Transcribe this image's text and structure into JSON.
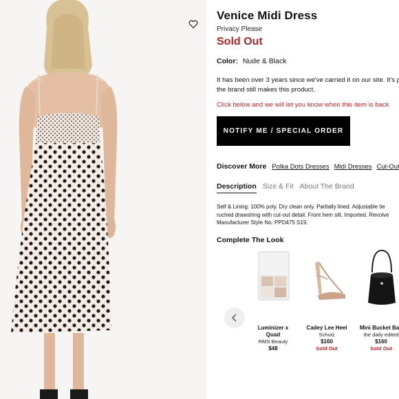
{
  "product": {
    "title": "Venice Midi Dress",
    "brand": "Privacy Please",
    "status": "Sold Out",
    "color_label": "Color:",
    "color_value": "Nude & Black",
    "availability_note": "It has been over 3 years since we've carried it on our site. It's possible the brand still makes this product.",
    "notify_prompt": "Click below and we will let you know when this item is back",
    "notify_button": "NOTIFY ME / SPECIAL ORDER"
  },
  "discover": {
    "label": "Discover More",
    "links": [
      "Polka Dots Dresses",
      "Midi Dresses",
      "Cut-Out"
    ]
  },
  "tabs": [
    {
      "label": "Description",
      "active": true
    },
    {
      "label": "Size & Fit",
      "active": false
    },
    {
      "label": "About The Brand",
      "active": false
    }
  ],
  "description": {
    "line1": "Self & Lining: 100% poly. Dry clean only. Partially lined. Adjustable tie",
    "line2": "ruched drawstring with cut-out detail. Front hem slit. Imported. Revolve",
    "line3": "Manufacturer Style No. PPD475 S19."
  },
  "complete_the_look": {
    "heading": "Complete The Look",
    "items": [
      {
        "name_line1": "Luminizer x",
        "name_line2": "Quad",
        "brand": "RMS Beauty",
        "price": "$48",
        "status": ""
      },
      {
        "name_line1": "Cadey Lee Heel",
        "name_line2": "",
        "brand": "Schutz",
        "price": "$160",
        "status": "Sold Out"
      },
      {
        "name_line1": "Mini Bucket Bag",
        "name_line2": "",
        "brand": "the daily edited",
        "price": "$160",
        "status": "Sold Out"
      }
    ]
  },
  "icons": {
    "wishlist": "heart-icon",
    "carousel_prev": "chevron-left-icon"
  },
  "colors": {
    "sold_out": "#a5282d",
    "button_bg": "#000000",
    "button_text": "#ffffff"
  }
}
